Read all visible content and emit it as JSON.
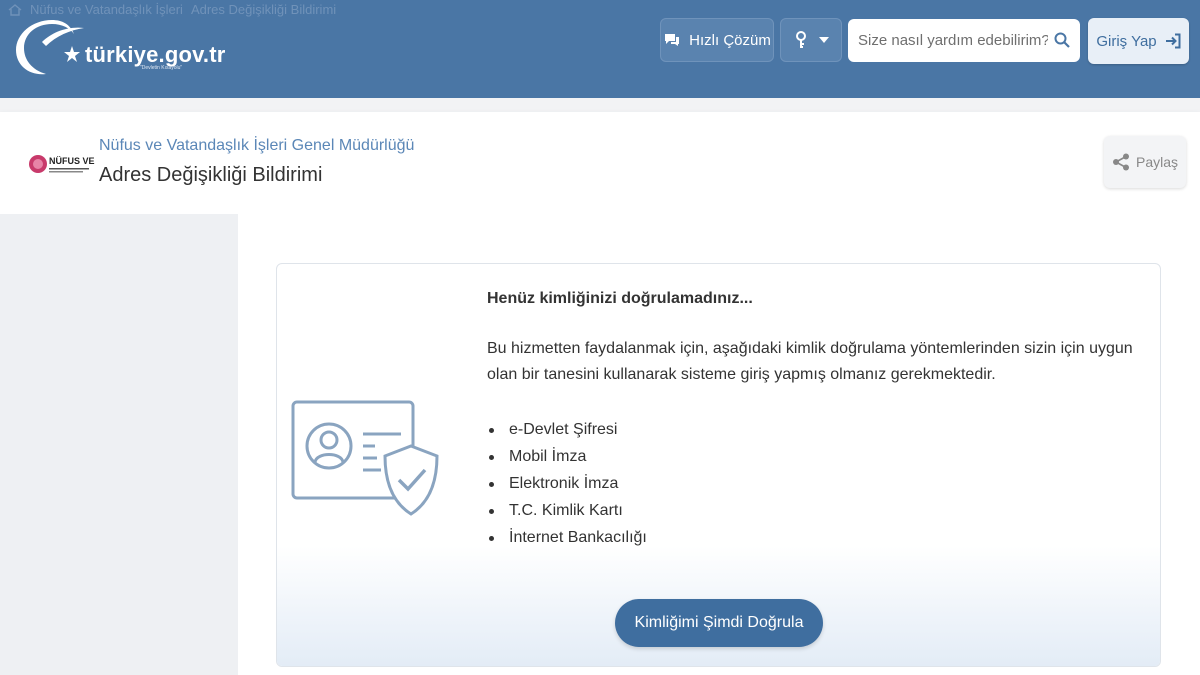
{
  "breadcrumb": [
    "Nüfus ve Vatandaşlık İşleri",
    "Adres Değişikliği Bildirimi"
  ],
  "brand": {
    "name": "türkiye.gov.tr",
    "tagline": "\"Devletin Kısayolu\""
  },
  "topbar": {
    "quick_solution": "Hızlı Çözüm",
    "search_placeholder": "Size nasıl yardım edebilirim?",
    "login": "Giriş Yap"
  },
  "header": {
    "institution": "Nüfus ve Vatandaşlık İşleri Genel Müdürlüğü",
    "institution_logo_text": "NÜFUS VE",
    "title": "Adres Değişikliği Bildirimi",
    "share": "Paylaş"
  },
  "notice": {
    "heading": "Henüz kimliğinizi doğrulamadınız...",
    "description": "Bu hizmetten faydalanmak için, aşağıdaki kimlik doğrulama yöntemlerinden sizin için uygun olan bir tanesini kullanarak sisteme giriş yapmış olmanız gerekmektedir.",
    "methods": [
      "e-Devlet Şifresi",
      "Mobil İmza",
      "Elektronik İmza",
      "T.C. Kimlik Kartı",
      "İnternet Bankacılığı"
    ],
    "verify_button": "Kimliğimi Şimdi Doğrula"
  },
  "colors": {
    "topbar": "#4a76a5",
    "accent": "#3f6e9f",
    "link": "#5b87b7"
  }
}
